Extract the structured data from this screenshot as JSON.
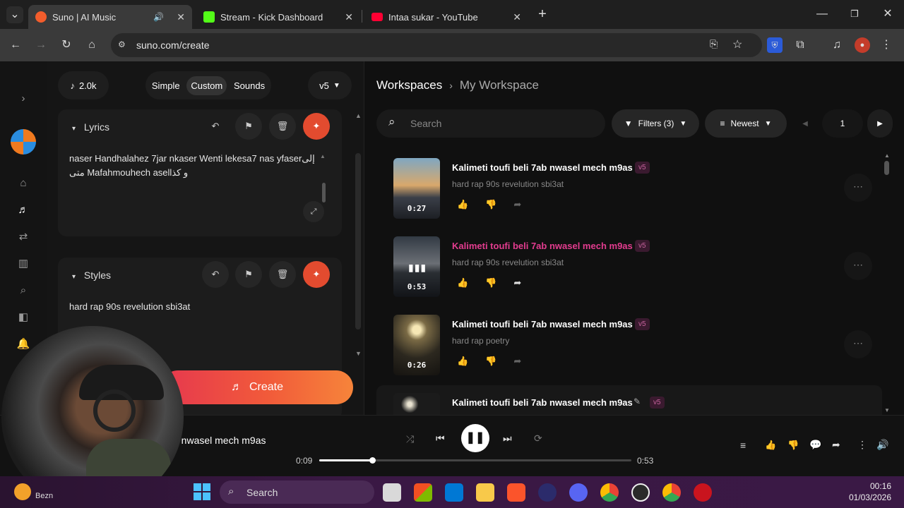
{
  "browser": {
    "tabs": [
      {
        "label": "Suno | AI Music",
        "color": "#f35d2c"
      },
      {
        "label": "Stream - Kick Dashboard",
        "color": "#53fc18"
      },
      {
        "label": "Intaa sukar - YouTube",
        "color": "#ff0033"
      }
    ],
    "url": "suno.com/create"
  },
  "left": {
    "credits": "2.0k",
    "modes": [
      "Simple",
      "Custom",
      "Sounds"
    ],
    "selected_mode": "Custom",
    "version": "v5",
    "lyrics_label": "Lyrics",
    "lyrics_line1": "naser Handhalahez 7jar nkaser Wenti lekesa7 nas yfaserإلى",
    "lyrics_line2": "متى Mafahmouhech asellو كذ",
    "styles_label": "Styles",
    "styles_text": "hard rap 90s revelution sbi3at",
    "create_label": "Create"
  },
  "right": {
    "breadcrumb_root": "Workspaces",
    "breadcrumb_current": "My Workspace",
    "search_placeholder": "Search",
    "filters_label": "Filters (3)",
    "sort_label": "Newest",
    "page": "1",
    "songs": [
      {
        "title": "Kalimeti toufi beli 7ab nwasel mech m9as",
        "style": "hard rap 90s revelution sbi3at",
        "duration": "0:27",
        "version": "v5"
      },
      {
        "title": "Kalimeti toufi beli 7ab nwasel mech m9as",
        "style": "hard rap 90s revelution sbi3at",
        "duration": "0:53",
        "version": "v5",
        "playing": true
      },
      {
        "title": "Kalimeti toufi beli 7ab nwasel mech m9as",
        "style": "hard rap poetry",
        "duration": "0:26",
        "version": "v5"
      },
      {
        "title": "Kalimeti toufi beli 7ab nwasel mech m9as",
        "style": "",
        "duration": "",
        "version": "v5"
      }
    ]
  },
  "player": {
    "track_title": "b nwasel mech m9as",
    "elapsed": "0:09",
    "total": "0:53",
    "progress": 0.17
  },
  "taskbar": {
    "search_label": "Search",
    "time": "00:16",
    "date": "01/03/2026",
    "weather_label": "Bezn"
  }
}
